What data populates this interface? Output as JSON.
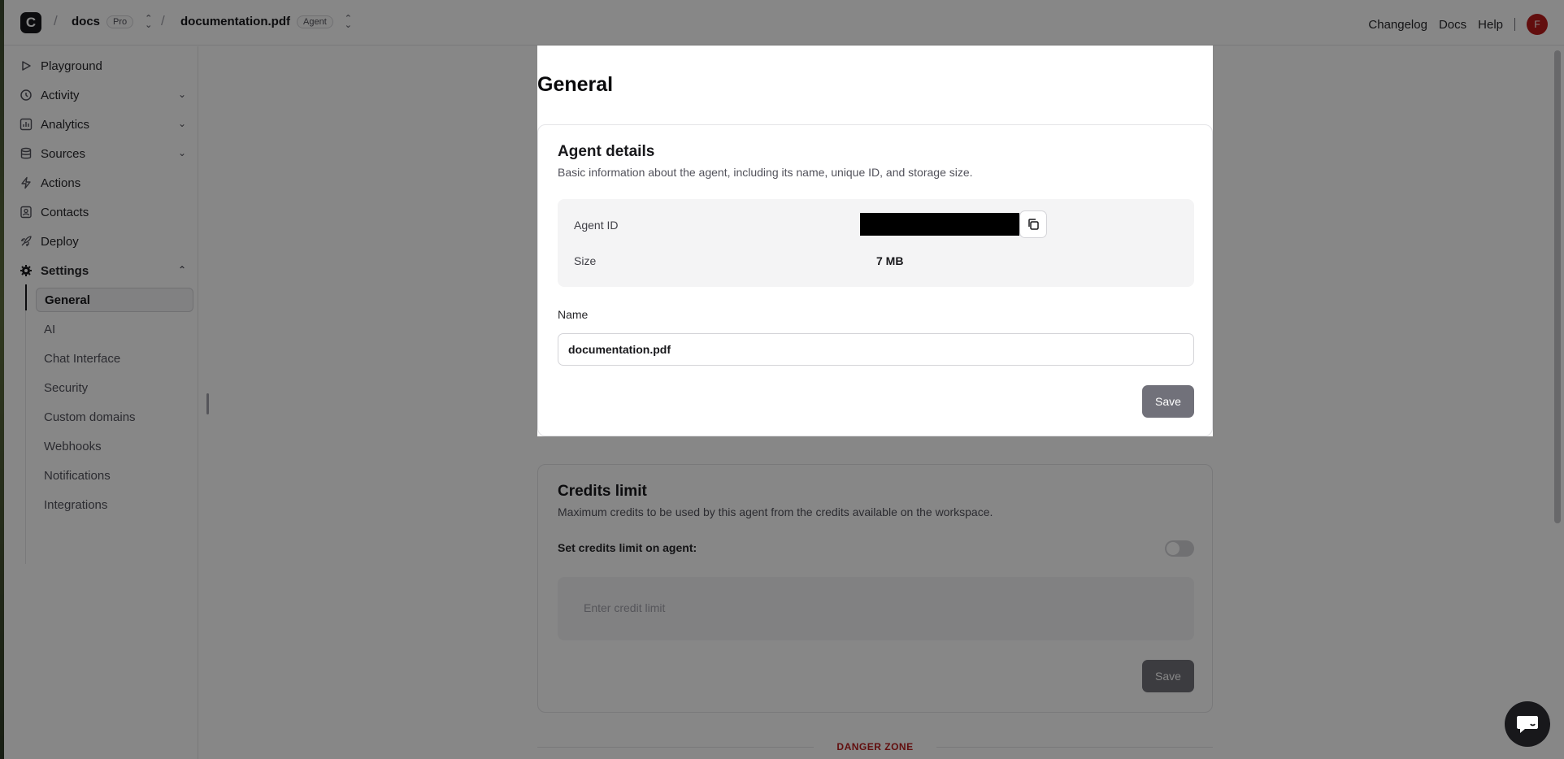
{
  "header": {
    "logo_letter": "C",
    "workspace": "docs",
    "workspace_badge": "Pro",
    "agent": "documentation.pdf",
    "agent_badge": "Agent",
    "links": [
      "Changelog",
      "Docs",
      "Help"
    ],
    "avatar_initial": "F"
  },
  "sidebar": {
    "items": [
      {
        "label": "Playground",
        "icon": "play-icon"
      },
      {
        "label": "Activity",
        "icon": "history-icon"
      },
      {
        "label": "Analytics",
        "icon": "bar-chart-icon"
      },
      {
        "label": "Sources",
        "icon": "database-icon"
      },
      {
        "label": "Actions",
        "icon": "bolt-icon"
      },
      {
        "label": "Contacts",
        "icon": "contacts-icon"
      },
      {
        "label": "Deploy",
        "icon": "rocket-icon"
      },
      {
        "label": "Settings",
        "icon": "gear-icon"
      }
    ],
    "settings_items": [
      "General",
      "AI",
      "Chat Interface",
      "Security",
      "Custom domains",
      "Webhooks",
      "Notifications",
      "Integrations"
    ]
  },
  "main": {
    "page_title": "General",
    "agent_details": {
      "title": "Agent details",
      "description": "Basic information about the agent, including its name, unique ID, and storage size.",
      "agent_id_label": "Agent ID",
      "size_label": "Size",
      "size_value": "7 MB",
      "name_label": "Name",
      "name_value": "documentation.pdf",
      "save_label": "Save"
    },
    "credits_limit": {
      "title": "Credits limit",
      "description": "Maximum credits to be used by this agent from the credits available on the workspace.",
      "toggle_label": "Set credits limit on agent:",
      "placeholder": "Enter credit limit",
      "save_label": "Save"
    },
    "danger_zone": "DANGER ZONE"
  }
}
